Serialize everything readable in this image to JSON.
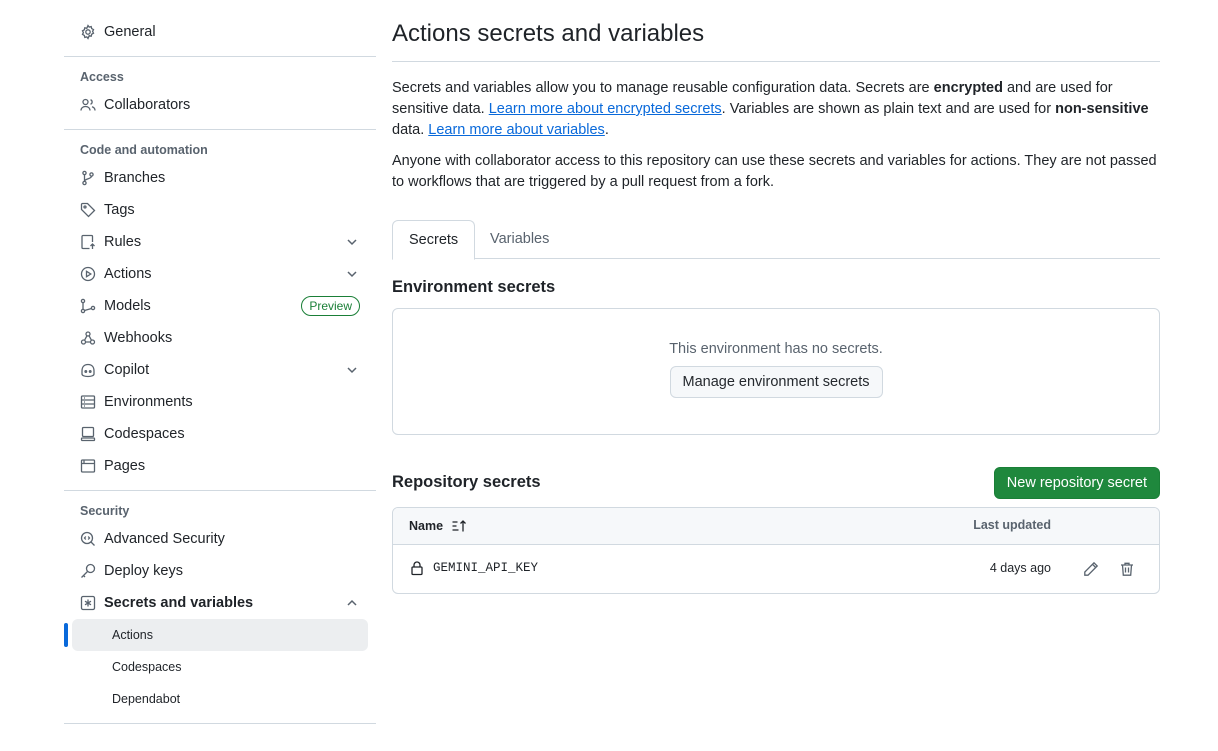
{
  "sidebar": {
    "general": "General",
    "access": {
      "heading": "Access",
      "collaborators": "Collaborators"
    },
    "code_automation": {
      "heading": "Code and automation",
      "branches": "Branches",
      "tags": "Tags",
      "rules": "Rules",
      "actions": "Actions",
      "models": "Models",
      "models_badge": "Preview",
      "webhooks": "Webhooks",
      "copilot": "Copilot",
      "environments": "Environments",
      "codespaces": "Codespaces",
      "pages": "Pages"
    },
    "security": {
      "heading": "Security",
      "advanced_security": "Advanced Security",
      "deploy_keys": "Deploy keys",
      "secrets_and_variables": "Secrets and variables",
      "sub": {
        "actions": "Actions",
        "codespaces": "Codespaces",
        "dependabot": "Dependabot"
      }
    }
  },
  "main": {
    "title": "Actions secrets and variables",
    "intro": {
      "part1": "Secrets and variables allow you to manage reusable configuration data. Secrets are ",
      "bold1": "encrypted",
      "part2": " and are used for sensitive data. ",
      "link1": "Learn more about encrypted secrets",
      "part3": ". Variables are shown as plain text and are used for ",
      "bold2": "non-sensitive",
      "part4": " data. ",
      "link2": "Learn more about variables",
      "part5": "."
    },
    "note": "Anyone with collaborator access to this repository can use these secrets and variables for actions. They are not passed to workflows that are triggered by a pull request from a fork.",
    "tabs": [
      "Secrets",
      "Variables"
    ],
    "environment": {
      "title": "Environment secrets",
      "empty_text": "This environment has no secrets.",
      "manage_button": "Manage environment secrets"
    },
    "repository": {
      "title": "Repository secrets",
      "new_button": "New repository secret",
      "columns": {
        "name": "Name",
        "last_updated": "Last updated"
      },
      "rows": [
        {
          "name": "GEMINI_API_KEY",
          "updated": "4 days ago"
        }
      ]
    }
  }
}
